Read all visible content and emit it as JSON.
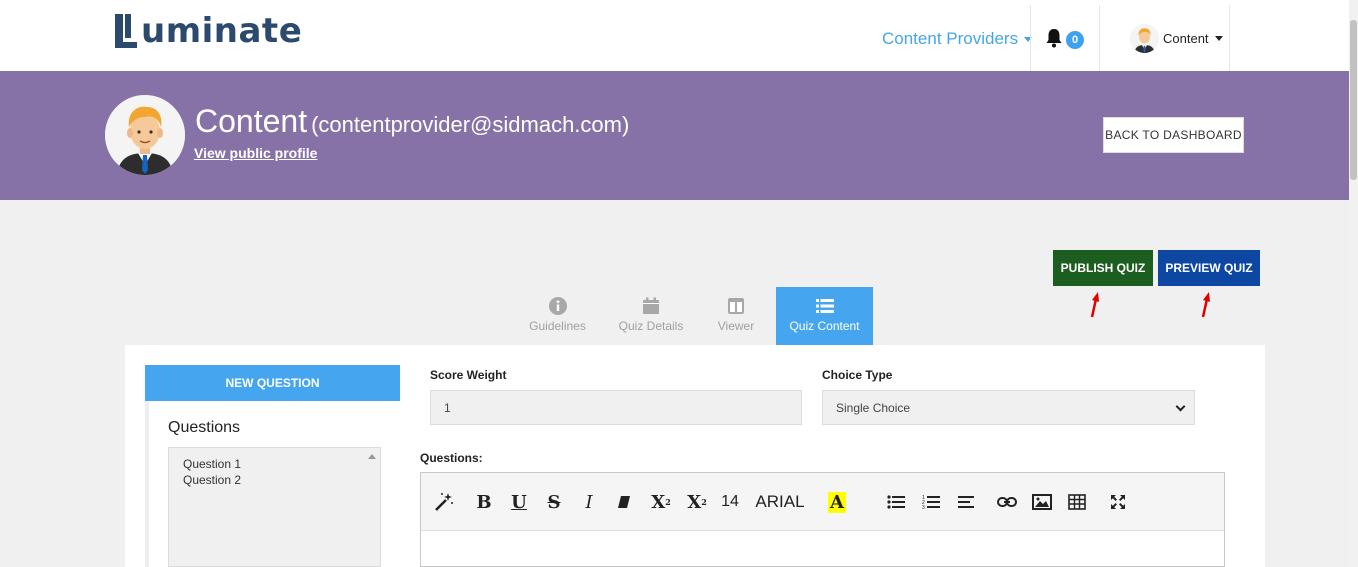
{
  "header": {
    "logo_text": "uminate",
    "nav_providers": "Content Providers",
    "notifications_count": "0",
    "user_menu": "Content"
  },
  "banner": {
    "name": "Content",
    "email": "(contentprovider@sidmach.com)",
    "profile_link": "View public profile",
    "back_button": "BACK TO DASHBOARD"
  },
  "actions": {
    "publish": "PUBLISH QUIZ",
    "preview": "PREVIEW QUIZ"
  },
  "tabs": [
    {
      "label": "Guidelines",
      "icon": "info-icon"
    },
    {
      "label": "Quiz Details",
      "icon": "calendar-icon"
    },
    {
      "label": "Viewer",
      "icon": "columns-icon"
    },
    {
      "label": "Quiz Content",
      "icon": "list-icon",
      "active": true
    }
  ],
  "sidebar": {
    "new_question": "NEW QUESTION",
    "title": "Questions",
    "items": [
      "Question 1",
      "Question 2"
    ]
  },
  "form": {
    "score_weight_label": "Score Weight",
    "score_weight_value": "1",
    "choice_type_label": "Choice Type",
    "choice_type_value": "Single Choice",
    "questions_label": "Questions:"
  },
  "editor": {
    "font_size": "14",
    "font_family": "ARIAL",
    "icons": [
      "magic-icon",
      "bold-icon",
      "underline-icon",
      "strikethrough-icon",
      "italic-icon",
      "eraser-icon",
      "superscript-icon",
      "subscript-icon",
      "font-size",
      "font-family",
      "highlight-icon",
      "unordered-list-icon",
      "ordered-list-icon",
      "align-icon",
      "link-icon",
      "image-icon",
      "table-icon",
      "fullscreen-icon"
    ]
  },
  "colors": {
    "banner": "#8672a6",
    "accent": "#45a6ef",
    "publish": "#1b5e20",
    "preview": "#0d47a1"
  }
}
